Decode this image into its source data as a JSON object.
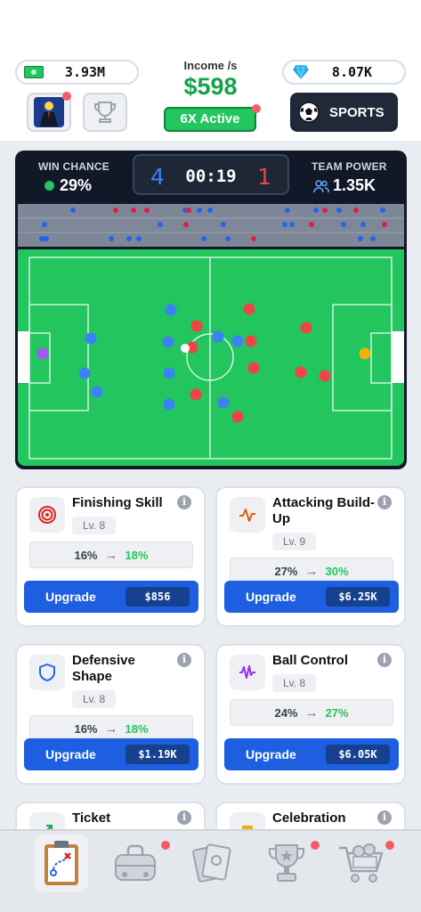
{
  "header": {
    "cash": "3.93M",
    "gems": "8.07K",
    "income_label": "Income /s",
    "income_value": "$598",
    "active_label": "6X Active",
    "sports_label": "SPORTS",
    "colors": {
      "income": "#16a34a",
      "active": "#22c55e",
      "sports_bg": "#1f2937"
    }
  },
  "match": {
    "win_chance_label": "WIN CHANCE",
    "win_chance_value": "29%",
    "team_power_label": "TEAM POWER",
    "team_power_value": "1.35K",
    "score_home": "4",
    "score_away": "1",
    "timer": "00:19",
    "colors": {
      "home": "#3b82f6",
      "away": "#ef4444",
      "pitch": "#22c55e"
    }
  },
  "upgrades": [
    {
      "title": "Finishing Skill",
      "level": "Lv. 8",
      "from": "16%",
      "to": "18%",
      "button": "Upgrade",
      "price": "$856",
      "icon": "target-icon"
    },
    {
      "title": "Attacking Build-Up",
      "level": "Lv. 9",
      "from": "27%",
      "to": "30%",
      "button": "Upgrade",
      "price": "$6.25K",
      "icon": "pulse-icon"
    },
    {
      "title": "Defensive Shape",
      "level": "Lv. 8",
      "from": "16%",
      "to": "18%",
      "button": "Upgrade",
      "price": "$1.19K",
      "icon": "shield-icon"
    },
    {
      "title": "Ball Control",
      "level": "Lv. 8",
      "from": "24%",
      "to": "27%",
      "button": "Upgrade",
      "price": "$6.05K",
      "icon": "wave-icon"
    },
    {
      "title": "Ticket",
      "icon": "ticket-icon"
    },
    {
      "title": "Celebration",
      "icon": "cup-icon"
    }
  ],
  "nav": [
    "clipboard-tactics-icon",
    "bag-icon",
    "cards-icon",
    "trophy-icon",
    "cart-icon"
  ]
}
